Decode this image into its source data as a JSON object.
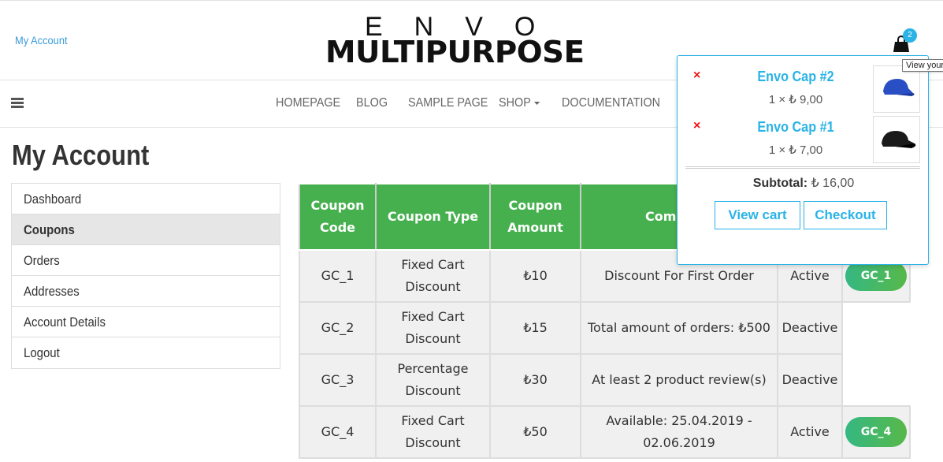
{
  "header": {
    "my_account_link": "My Account",
    "logo_top": "ENVO",
    "logo_bottom": "MULTIPURPOSE",
    "cart_count": "2",
    "cart_icon": "shopping-bag-icon",
    "tooltip": "View your"
  },
  "nav": {
    "menu_icon": "hamburger-icon",
    "items": [
      "HOMEPAGE",
      "BLOG",
      "SAMPLE PAGE",
      "SHOP",
      "DOCUMENTATION"
    ]
  },
  "page": {
    "title": "My Account"
  },
  "account_nav": {
    "items": [
      "Dashboard",
      "Coupons",
      "Orders",
      "Addresses",
      "Account Details",
      "Logout"
    ],
    "active": "Coupons"
  },
  "coupons": {
    "headers": {
      "code": "Coupon Code",
      "type": "Coupon Type",
      "amount": "Coupon Amount",
      "comment": "Comment"
    },
    "rows": [
      {
        "code": "GC_1",
        "type": "Fixed Cart Discount",
        "amount": "₺10",
        "comment": "Discount For First Order",
        "status": "Active",
        "button": "GC_1"
      },
      {
        "code": "GC_2",
        "type": "Fixed Cart Discount",
        "amount": "₺15",
        "comment": "Total amount of orders: ₺500",
        "status": "Deactive",
        "button": ""
      },
      {
        "code": "GC_3",
        "type": "Percentage Discount",
        "amount": "₺30",
        "comment": "At least 2 product review(s)",
        "status": "Deactive",
        "button": ""
      },
      {
        "code": "GC_4",
        "type": "Fixed Cart Discount",
        "amount": "₺50",
        "comment": "Available: 25.04.2019 - 02.06.2019",
        "status": "Active",
        "button": "GC_4"
      }
    ],
    "colors": {
      "header_bg": "#46b04e",
      "active": "#1d8a1d",
      "deactive": "#e01b1b"
    }
  },
  "mini_cart": {
    "items": [
      {
        "name": "Envo Cap #2",
        "qty": "1 ×",
        "price": "₺ 9,00",
        "remove": "×",
        "image": "blue-cap"
      },
      {
        "name": "Envo Cap #1",
        "qty": "1 ×",
        "price": "₺ 7,00",
        "remove": "×",
        "image": "black-cap"
      }
    ],
    "subtotal_label": "Subtotal:",
    "subtotal_value": "₺ 16,00",
    "view_cart": "View cart",
    "checkout": "Checkout",
    "accent": "#2ab3e6"
  }
}
